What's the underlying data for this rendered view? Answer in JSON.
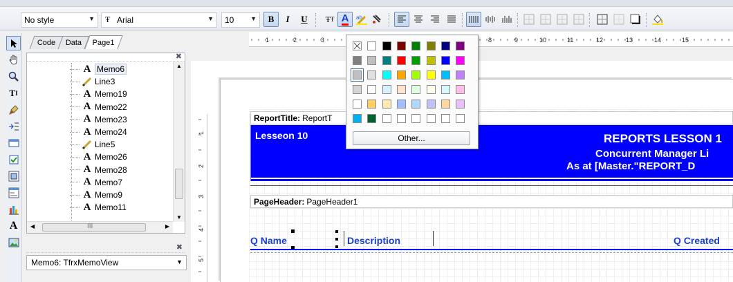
{
  "toolbar": {
    "style_value": "No style",
    "font_value": "Arial",
    "size_value": "10",
    "bold": "B",
    "italic": "I",
    "underline": "U"
  },
  "tabs": [
    {
      "label": "Code"
    },
    {
      "label": "Data"
    },
    {
      "label": "Page1"
    }
  ],
  "tree": {
    "items": [
      {
        "label": "Memo6",
        "kind": "memo",
        "selected": true
      },
      {
        "label": "Line3",
        "kind": "line"
      },
      {
        "label": "Memo19",
        "kind": "memo"
      },
      {
        "label": "Memo22",
        "kind": "memo"
      },
      {
        "label": "Memo23",
        "kind": "memo"
      },
      {
        "label": "Memo24",
        "kind": "memo"
      },
      {
        "label": "Line5",
        "kind": "line"
      },
      {
        "label": "Memo26",
        "kind": "memo"
      },
      {
        "label": "Memo28",
        "kind": "memo"
      },
      {
        "label": "Memo7",
        "kind": "memo"
      },
      {
        "label": "Memo9",
        "kind": "memo"
      },
      {
        "label": "Memo11",
        "kind": "memo"
      }
    ],
    "hscroll_grip": "III"
  },
  "object_inspector": {
    "selected": "Memo6: TfrxMemoView"
  },
  "ruler": {
    "top_numbers": [
      "1",
      "2",
      "3",
      "8",
      "9",
      "10",
      "11",
      "12",
      "13",
      "14",
      "15"
    ],
    "left_numbers": [
      "1",
      "2",
      "3",
      "4",
      "5"
    ]
  },
  "report": {
    "title_band_type": "ReportTitle:",
    "title_band_name": "ReportT",
    "lesson": "Lesseon 10",
    "title_line1": "REPORTS LESSON 1",
    "title_line2": "Concurrent Manager Li",
    "title_line3": "As at [Master.\"REPORT_D",
    "page_header_type": "PageHeader:",
    "page_header_name": "PageHeader1",
    "col_name": "Q Name",
    "col_description": "Description",
    "col_created": "Q Created"
  },
  "color_popup": {
    "other_label": "Other...",
    "rows": [
      [
        "none",
        "#ffffff",
        "#000000",
        "#800000",
        "#008000",
        "#808000",
        "#000080",
        "#800080"
      ],
      [
        "#808080",
        "#c0c0c0",
        "#008080",
        "#ff0000",
        "#00a000",
        "#c0c000",
        "#0000ff",
        "#ff00ff"
      ],
      [
        "#c0c0c0",
        "#e0e0e0",
        "#00ffff",
        "#ffa500",
        "#a0ff00",
        "#ffff00",
        "#00bfff",
        "#c080ff"
      ],
      [
        "#d4d4d4",
        "#ffffff",
        "#d8f0ff",
        "#ffe4d0",
        "#e0ffe0",
        "#fffff0",
        "#d8f8ff",
        "#ffc0e8"
      ],
      [
        "#ffffff",
        "#ffd060",
        "#ffe8b0",
        "#a0c0ff",
        "#b0d8ff",
        "#c0c0ff",
        "#ffd8a0",
        "#e8c0ff"
      ],
      [
        "#00b0f0",
        "#006030",
        "#ffffff",
        "#ffffff",
        "#ffffff",
        "#ffffff",
        "#ffffff",
        "#ffffff"
      ]
    ],
    "highlight_row": 2,
    "highlight_col": 0
  },
  "colors": {
    "band_blue": "#0000ff",
    "memo_blue": "#1a3fd1",
    "selection": "#6d8bb8"
  }
}
